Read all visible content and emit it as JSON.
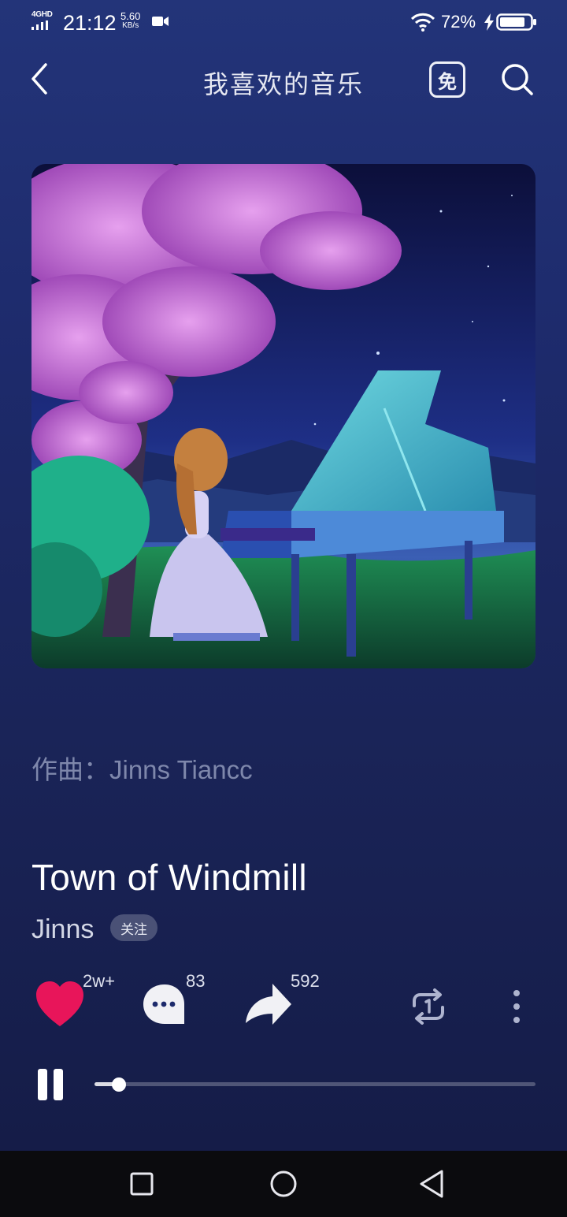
{
  "status_bar": {
    "network": "4GHD",
    "time": "21:12",
    "speed_value": "5.60",
    "speed_unit": "KB/s",
    "battery_percent": "72%"
  },
  "header": {
    "title": "我喜欢的音乐",
    "vip_label": "免"
  },
  "composer": "作曲：Jinns Tiancc",
  "song": {
    "title": "Town of Windmill",
    "artist": "Jinns",
    "follow_label": "关注"
  },
  "actions": {
    "like_count": "2w+",
    "comment_count": "83",
    "share_count": "592"
  },
  "player": {
    "progress": 0.055
  },
  "colors": {
    "like_heart": "#e8155a",
    "background_top": "#233479",
    "background_bottom": "#141b45",
    "nav_bar": "#0b0b0e"
  },
  "icons": {
    "back": "chevron-left-icon",
    "vip": "free-badge-icon",
    "search": "search-icon",
    "like": "heart-icon",
    "comment": "comment-bubble-icon",
    "share": "share-arrow-icon",
    "repeat": "repeat-icon",
    "more": "more-vertical-icon",
    "pause": "pause-icon"
  }
}
